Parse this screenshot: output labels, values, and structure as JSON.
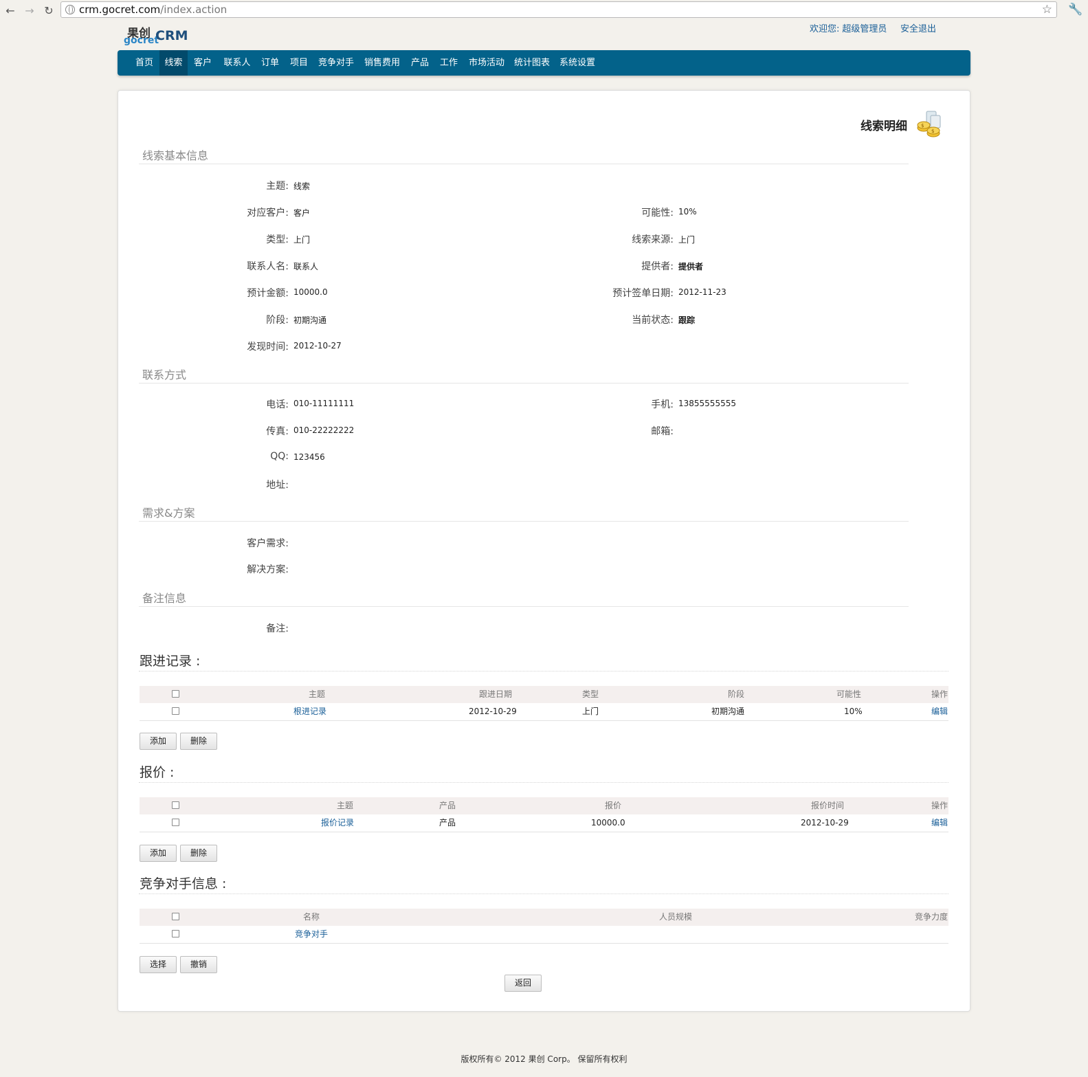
{
  "browser": {
    "url_host": "crm.gocret.com",
    "url_path": "/index.action"
  },
  "header": {
    "logo_cn": "果创",
    "logo_en": "gocret",
    "logo_crm": "CRM",
    "welcome_label": "欢迎您:",
    "user_name": "超级管理员",
    "logout_label": "安全退出"
  },
  "menu": {
    "items": [
      "首页",
      "线索",
      "客户",
      "联系人",
      "订单",
      "项目",
      "竞争对手",
      "销售费用",
      "产品",
      "工作",
      "市场活动",
      "统计图表",
      "系统设置"
    ],
    "active": "线索"
  },
  "page": {
    "title": "线索明细"
  },
  "basic": {
    "section_title": "线索基本信息",
    "subject_label": "主题:",
    "subject": "线索",
    "customer_label": "对应客户:",
    "customer": "客户",
    "probability_label": "可能性:",
    "probability": "10%",
    "type_label": "类型:",
    "type": "上门",
    "source_label": "线索来源:",
    "source": "上门",
    "contact_label": "联系人名:",
    "contact": "联系人",
    "provider_label": "提供者:",
    "provider": "提供者",
    "amount_label": "预计金额:",
    "amount": "10000.0",
    "sign_date_label": "预计签单日期:",
    "sign_date": "2012-11-23",
    "stage_label": "阶段:",
    "stage": "初期沟通",
    "status_label": "当前状态:",
    "status": "跟踪",
    "found_label": "发现时间:",
    "found": "2012-10-27"
  },
  "contact_info": {
    "section_title": "联系方式",
    "phone_label": "电话:",
    "phone": "010-11111111",
    "mobile_label": "手机:",
    "mobile": "13855555555",
    "fax_label": "传真:",
    "fax": "010-22222222",
    "email_label": "邮箱:",
    "email": "",
    "qq_label": "QQ:",
    "qq": "123456",
    "address_label": "地址:",
    "address": ""
  },
  "needs": {
    "section_title": "需求&方案",
    "demand_label": "客户需求:",
    "demand": "",
    "solution_label": "解决方案:",
    "solution": ""
  },
  "remarks": {
    "section_title": "备注信息",
    "remark_label": "备注:",
    "remark": ""
  },
  "followups": {
    "title": "跟进记录 :",
    "headers": {
      "subject": "主题",
      "date": "跟进日期",
      "type": "类型",
      "stage": "阶段",
      "probability": "可能性",
      "action": "操作"
    },
    "rows": [
      {
        "subject": "根进记录",
        "date": "2012-10-29",
        "type": "上门",
        "stage": "初期沟通",
        "probability": "10%",
        "action": "编辑"
      }
    ],
    "add_label": "添加",
    "delete_label": "删除"
  },
  "quotes": {
    "title": "报价 :",
    "headers": {
      "subject": "主题",
      "product": "产品",
      "price": "报价",
      "time": "报价时间",
      "action": "操作"
    },
    "rows": [
      {
        "subject": "报价记录",
        "product": "产品",
        "price": "10000.0",
        "time": "2012-10-29",
        "action": "编辑"
      }
    ],
    "add_label": "添加",
    "delete_label": "删除"
  },
  "competitors": {
    "title": "竞争对手信息 :",
    "headers": {
      "name": "名称",
      "size": "人员规模",
      "strength": "竞争力度"
    },
    "rows": [
      {
        "name": "竞争对手",
        "size": "",
        "strength": ""
      }
    ],
    "select_label": "选择",
    "cancel_label": "撤销"
  },
  "back_label": "返回",
  "footer": "版权所有© 2012 果创 Corp。 保留所有权利"
}
